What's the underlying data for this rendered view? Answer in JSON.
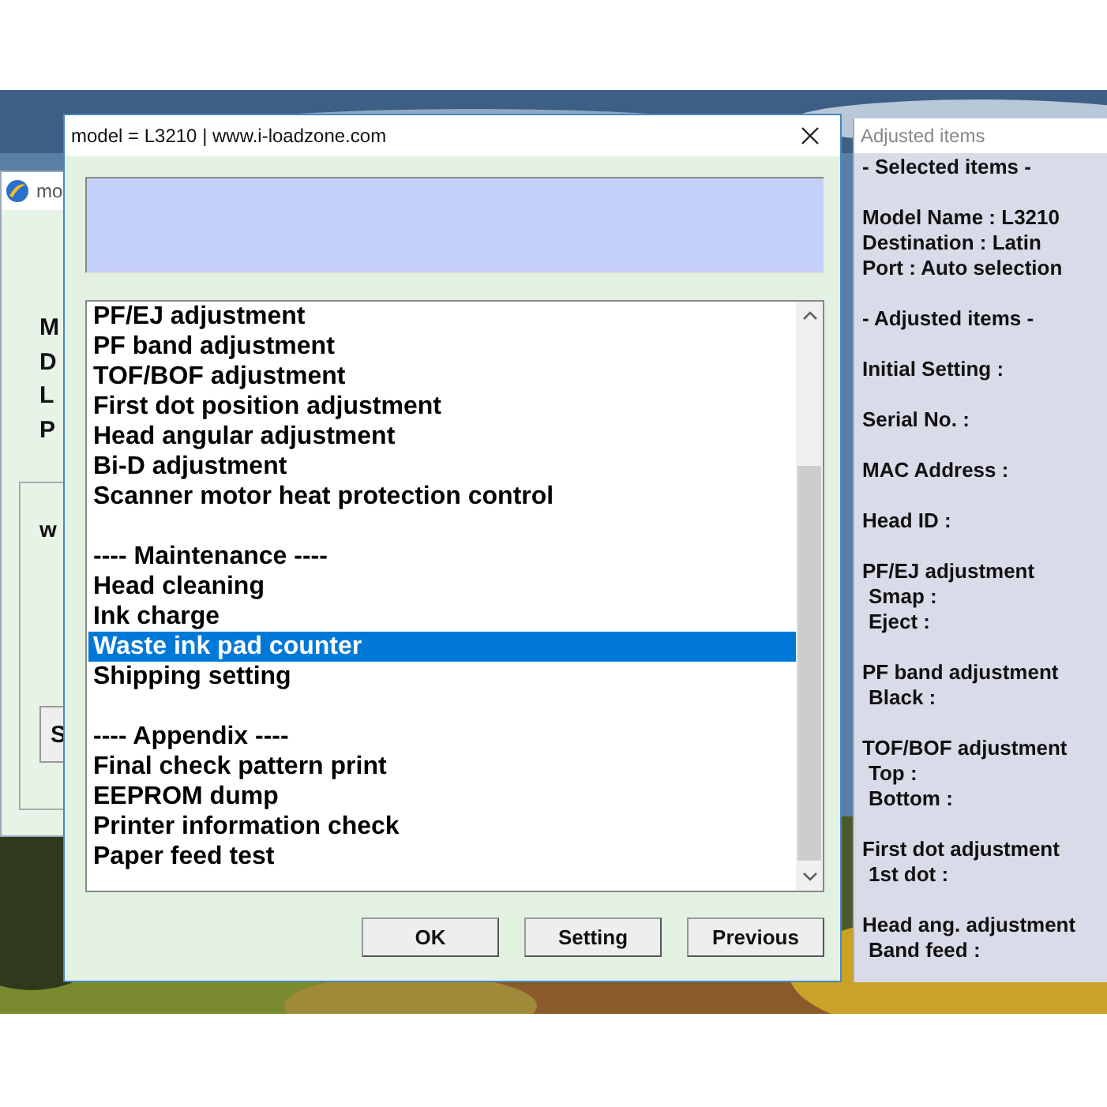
{
  "background_window": {
    "title": "mo",
    "labels": [
      "M",
      "D",
      "L",
      "P"
    ],
    "group_text": "w",
    "button": "S"
  },
  "dialog": {
    "title": "model = L3210 | www.i-loadzone.com",
    "list": [
      {
        "kind": "item",
        "text": "PF/EJ adjustment",
        "selected": false
      },
      {
        "kind": "item",
        "text": "PF band adjustment",
        "selected": false
      },
      {
        "kind": "item",
        "text": "TOF/BOF adjustment",
        "selected": false
      },
      {
        "kind": "item",
        "text": "First dot position adjustment",
        "selected": false
      },
      {
        "kind": "item",
        "text": "Head angular adjustment",
        "selected": false
      },
      {
        "kind": "item",
        "text": "Bi-D adjustment",
        "selected": false
      },
      {
        "kind": "item",
        "text": "Scanner motor heat protection control",
        "selected": false
      },
      {
        "kind": "spacer"
      },
      {
        "kind": "header",
        "text": "---- Maintenance ----",
        "selected": false
      },
      {
        "kind": "item",
        "text": "Head cleaning",
        "selected": false
      },
      {
        "kind": "item",
        "text": "Ink charge",
        "selected": false
      },
      {
        "kind": "item",
        "text": "Waste ink pad counter",
        "selected": true
      },
      {
        "kind": "item",
        "text": "Shipping setting",
        "selected": false
      },
      {
        "kind": "spacer"
      },
      {
        "kind": "header",
        "text": "---- Appendix ----",
        "selected": false
      },
      {
        "kind": "item",
        "text": "Final check pattern print",
        "selected": false
      },
      {
        "kind": "item",
        "text": "EEPROM dump",
        "selected": false
      },
      {
        "kind": "item",
        "text": "Printer information check",
        "selected": false
      },
      {
        "kind": "item",
        "text": "Paper feed test",
        "selected": false
      }
    ],
    "buttons": [
      "OK",
      "Setting",
      "Previous"
    ]
  },
  "adjusted_panel": {
    "title": "Adjusted items",
    "blocks": [
      {
        "lines": [
          "- Selected items -"
        ]
      },
      {
        "lines": [
          "Model Name : L3210",
          "Destination : Latin",
          "Port : Auto selection"
        ]
      },
      {
        "lines": [
          "- Adjusted items -"
        ]
      },
      {
        "lines": [
          "Initial Setting :"
        ]
      },
      {
        "lines": [
          "Serial No. :"
        ]
      },
      {
        "lines": [
          "MAC Address :"
        ]
      },
      {
        "lines": [
          "Head ID :"
        ]
      },
      {
        "lines": [
          "PF/EJ adjustment"
        ],
        "children": [
          "Smap :",
          "Eject :"
        ]
      },
      {
        "lines": [
          "PF band adjustment"
        ],
        "children": [
          "Black :"
        ]
      },
      {
        "lines": [
          "TOF/BOF adjustment"
        ],
        "children": [
          "Top :",
          "Bottom :"
        ]
      },
      {
        "lines": [
          "First dot adjustment"
        ],
        "children": [
          "1st dot :"
        ]
      },
      {
        "lines": [
          "Head ang. adjustment"
        ],
        "children": [
          "Band feed :"
        ]
      }
    ]
  }
}
